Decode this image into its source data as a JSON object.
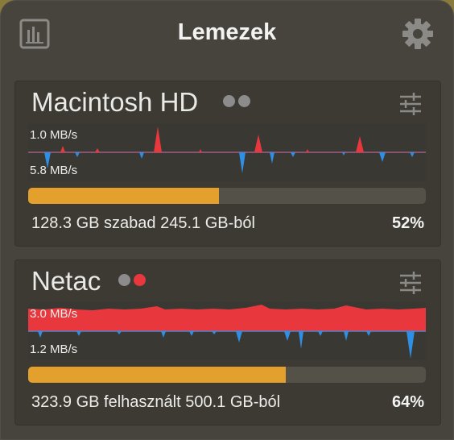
{
  "window": {
    "title": "Lemezek",
    "left_icon": "bar-chart-icon",
    "right_icon": "gear-icon"
  },
  "disks": [
    {
      "name": "Macintosh HD",
      "status_dots": [
        "#8c8c8c",
        "#8c8c8c"
      ],
      "settings_icon": "sliders-icon",
      "read_rate": "1.0 MB/s",
      "write_rate": "5.8 MB/s",
      "usage_text": "128.3 GB szabad 245.1 GB-ból",
      "percent_text": "52%",
      "usage_fraction": 0.48
    },
    {
      "name": "Netac",
      "status_dots": [
        "#8c8c8c",
        "#e8383e"
      ],
      "settings_icon": "sliders-icon",
      "read_rate": "3.0 MB/s",
      "write_rate": "1.2 MB/s",
      "usage_text": "323.9 GB felhasznált 500.1 GB-ból",
      "percent_text": "64%",
      "usage_fraction": 0.647
    }
  ],
  "colors": {
    "read": "#e8383e",
    "write": "#2e8fe6",
    "bar_fill": "#e3a02c"
  }
}
